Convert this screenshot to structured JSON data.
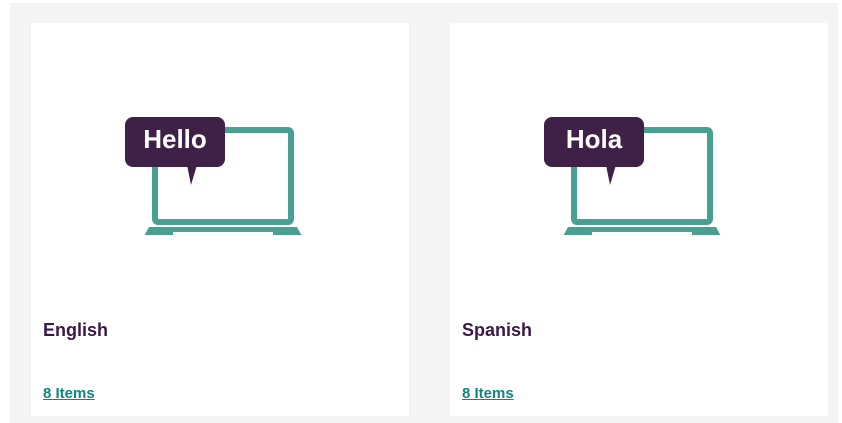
{
  "cards": [
    {
      "bubble_text": "Hello",
      "title": "English",
      "link": "8 Items"
    },
    {
      "bubble_text": "Hola",
      "title": "Spanish",
      "link": "8 Items"
    }
  ],
  "colors": {
    "laptop": "#4a9f93",
    "bubble": "#3f2147",
    "title": "#3a1a45",
    "link": "#11857d",
    "page_background": "#f4f4f4"
  }
}
